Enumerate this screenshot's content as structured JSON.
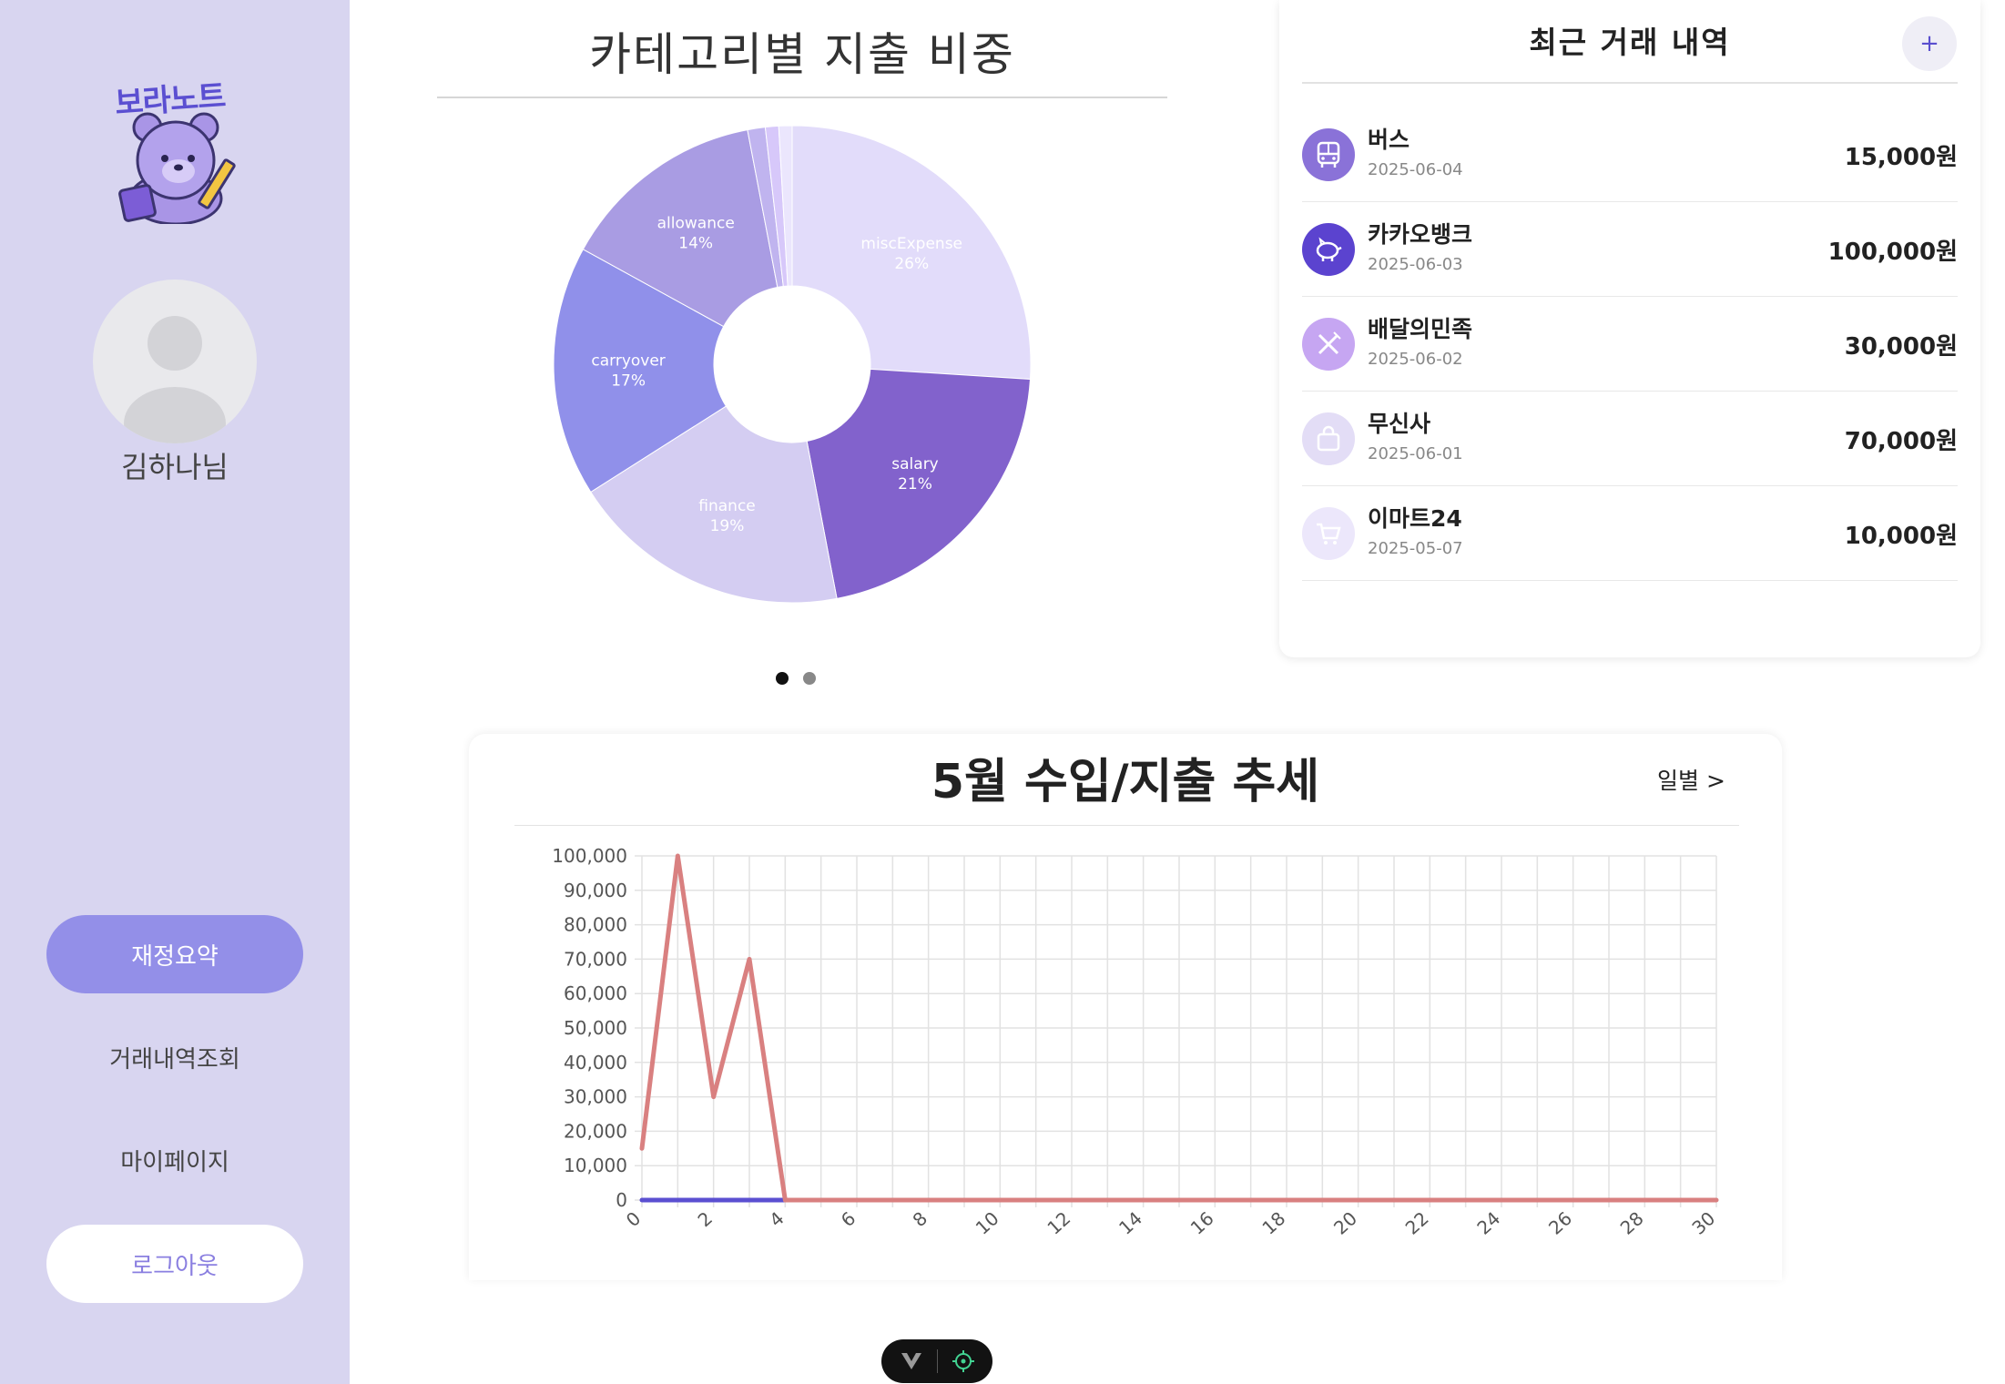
{
  "brand": {
    "logo_text": "보라노트"
  },
  "user": {
    "name": "김하나님"
  },
  "nav": {
    "items": [
      {
        "label": "재정요약",
        "active": true
      },
      {
        "label": "거래내역조회",
        "active": false
      },
      {
        "label": "마이페이지",
        "active": false
      }
    ],
    "logout_label": "로그아웃"
  },
  "pie_panel": {
    "title": "카테고리별 지출 비중",
    "carousel": {
      "pages": 2,
      "active": 0
    }
  },
  "recent": {
    "title": "최근 거래 내역",
    "add_label": "+",
    "items": [
      {
        "name": "버스",
        "date": "2025-06-04",
        "amount": "15,000원",
        "icon": "bus-icon",
        "color": "#8a72d8"
      },
      {
        "name": "카카오뱅크",
        "date": "2025-06-03",
        "amount": "100,000원",
        "icon": "piggy-bank-icon",
        "color": "#5b43cf"
      },
      {
        "name": "배달의민족",
        "date": "2025-06-02",
        "amount": "30,000원",
        "icon": "utensils-icon",
        "color": "#c6a6f2"
      },
      {
        "name": "무신사",
        "date": "2025-06-01",
        "amount": "70,000원",
        "icon": "shopping-bag-icon",
        "color": "#e3ddf6"
      },
      {
        "name": "이마트24",
        "date": "2025-05-07",
        "amount": "10,000원",
        "icon": "cart-icon",
        "color": "#ece7fb"
      }
    ]
  },
  "trend": {
    "title": "5월 수입/지출 추세",
    "link_label": "일별 >"
  },
  "chart_data": [
    {
      "type": "pie",
      "style": "donut",
      "slices": [
        {
          "label": "miscExpense",
          "percent": 26,
          "value_text": "26%",
          "color": "#e2dcfa"
        },
        {
          "label": "salary",
          "percent": 21,
          "value_text": "21%",
          "color": "#8262cc"
        },
        {
          "label": "finance",
          "percent": 19,
          "value_text": "19%",
          "color": "#d4cdf2"
        },
        {
          "label": "carryover",
          "percent": 17,
          "value_text": "17%",
          "color": "#9090ea"
        },
        {
          "label": "allowance",
          "percent": 14,
          "value_text": "14%",
          "color": "#a99ce3"
        },
        {
          "label": "",
          "percent": 1.2,
          "value_text": "",
          "color": "#c0b4ef"
        },
        {
          "label": "",
          "percent": 0.9,
          "value_text": "",
          "color": "#d7c8fa"
        },
        {
          "label": "",
          "percent": 0.9,
          "value_text": "",
          "color": "#ebe6fd"
        }
      ]
    },
    {
      "type": "line",
      "x": [
        0,
        1,
        2,
        3,
        4,
        5,
        6,
        7,
        8,
        9,
        10,
        11,
        12,
        13,
        14,
        15,
        16,
        17,
        18,
        19,
        20,
        21,
        22,
        23,
        24,
        25,
        26,
        27,
        28,
        29,
        30
      ],
      "x_ticks": [
        0,
        2,
        4,
        6,
        8,
        10,
        12,
        14,
        16,
        18,
        20,
        22,
        24,
        26,
        28,
        30
      ],
      "ylim": [
        0,
        100000
      ],
      "y_ticks": [
        "0",
        "10,000",
        "20,000",
        "30,000",
        "40,000",
        "50,000",
        "60,000",
        "70,000",
        "80,000",
        "90,000",
        "100,000"
      ],
      "grid": true,
      "series": [
        {
          "color": "#d98080",
          "values": [
            15000,
            100000,
            30000,
            70000,
            0,
            0,
            0,
            0,
            0,
            0,
            0,
            0,
            0,
            0,
            0,
            0,
            0,
            0,
            0,
            0,
            0,
            0,
            0,
            0,
            0,
            0,
            0,
            0,
            0,
            0,
            0
          ]
        },
        {
          "color": "#5b4fd1",
          "values": [
            0,
            0,
            0,
            0,
            0
          ]
        }
      ]
    }
  ]
}
